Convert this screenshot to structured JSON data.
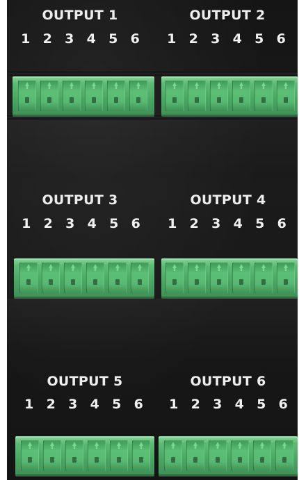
{
  "outputs": [
    {
      "title": "OUTPUT 1",
      "pins": [
        "1",
        "2",
        "3",
        "4",
        "5",
        "6"
      ]
    },
    {
      "title": "OUTPUT 2",
      "pins": [
        "1",
        "2",
        "3",
        "4",
        "5",
        "6"
      ]
    },
    {
      "title": "OUTPUT 3",
      "pins": [
        "1",
        "2",
        "3",
        "4",
        "5",
        "6"
      ]
    },
    {
      "title": "OUTPUT 4",
      "pins": [
        "1",
        "2",
        "3",
        "4",
        "5",
        "6"
      ]
    },
    {
      "title": "OUTPUT 5",
      "pins": [
        "1",
        "2",
        "3",
        "4",
        "5",
        "6"
      ]
    },
    {
      "title": "OUTPUT 6",
      "pins": [
        "1",
        "2",
        "3",
        "4",
        "5",
        "6"
      ]
    }
  ],
  "colors": {
    "panel": "#171717",
    "connector": "#4aa863",
    "label": "#eeeeee"
  }
}
